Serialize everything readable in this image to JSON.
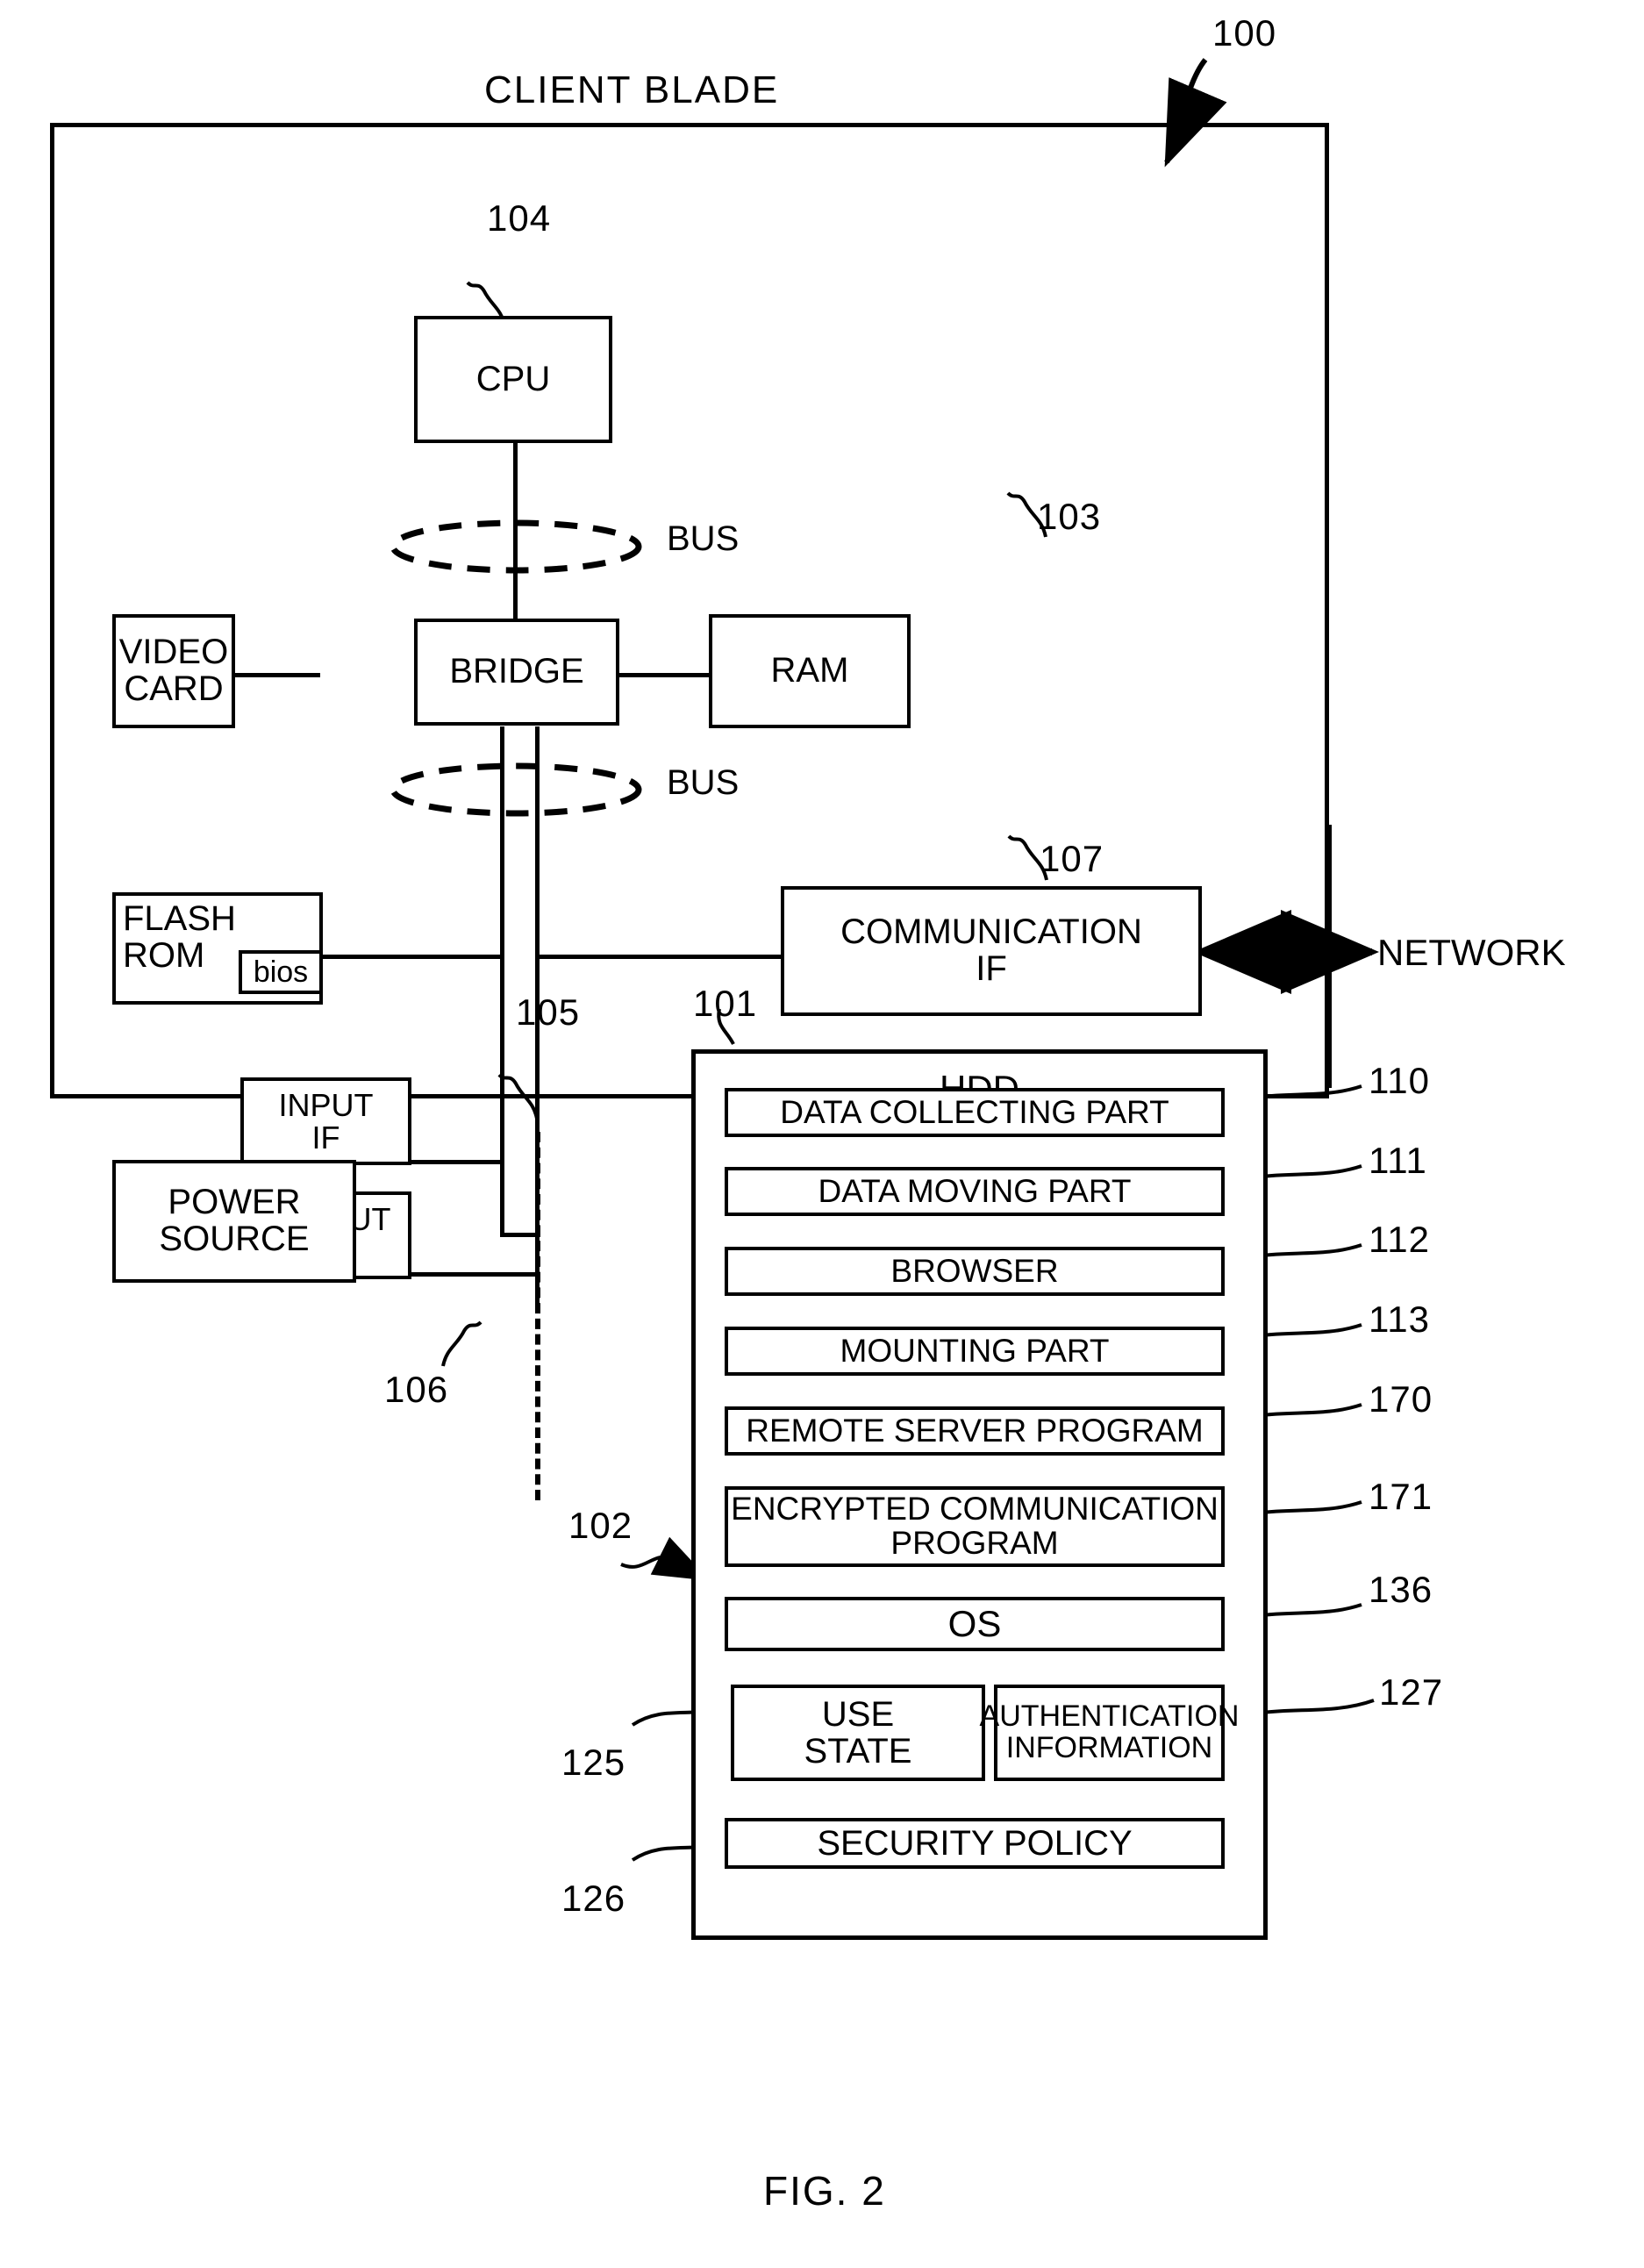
{
  "figure": {
    "caption": "FIG. 2",
    "title": "CLIENT BLADE",
    "system_ref": "100"
  },
  "components": {
    "cpu": {
      "label": "CPU",
      "ref": "104"
    },
    "bridge": {
      "label": "BRIDGE"
    },
    "ram": {
      "label": "RAM",
      "ref": "103"
    },
    "video_card": {
      "label": "VIDEO\nCARD"
    },
    "flash_rom": {
      "label": "FLASH\nROM",
      "inner_label": "bios"
    },
    "communication_if": {
      "label": "COMMUNICATION\nIF",
      "ref": "107"
    },
    "input_if": {
      "label": "INPUT\nIF",
      "ref": "105"
    },
    "output_if": {
      "label": "OUTPUT\nIF",
      "ref": "106"
    },
    "power_source": {
      "label": "POWER\nSOURCE"
    },
    "hdd": {
      "label": "HDD",
      "ref": "101"
    },
    "hdd_bus_ref": "102"
  },
  "buses": {
    "top": "BUS",
    "bottom": "BUS"
  },
  "network": {
    "label": "NETWORK"
  },
  "hdd_items": [
    {
      "label": "DATA COLLECTING PART",
      "ref": "110"
    },
    {
      "label": "DATA MOVING PART",
      "ref": "111"
    },
    {
      "label": "BROWSER",
      "ref": "112"
    },
    {
      "label": "MOUNTING PART",
      "ref": "113"
    },
    {
      "label": "REMOTE SERVER PROGRAM",
      "ref": "170"
    },
    {
      "label": "ENCRYPTED COMMUNICATION\nPROGRAM",
      "ref": "171"
    },
    {
      "label": "OS",
      "ref": "136"
    }
  ],
  "hdd_data_items": [
    {
      "label": "USE\nSTATE",
      "ref": "125"
    },
    {
      "label": "AUTHENTICATION\nINFORMATION",
      "ref": "127"
    },
    {
      "label": "SECURITY POLICY",
      "ref": "126"
    }
  ]
}
